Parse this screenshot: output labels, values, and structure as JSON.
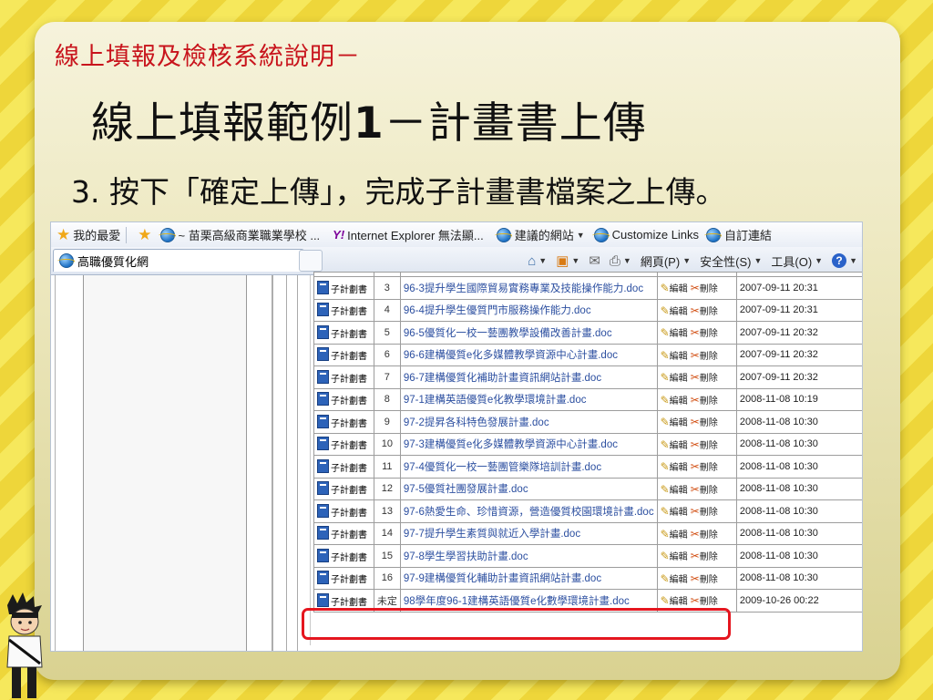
{
  "slide": {
    "subtitle": "線上填報及檢核系統說明－",
    "title_part1": "線上填報範例",
    "title_num": "1",
    "title_part2": "－計畫書上傳",
    "step_number": "3.",
    "step_text": " 按下「確定上傳」，完成子計畫書檔案之上傳。"
  },
  "browser": {
    "favorites_bar": {
      "favorites_label": "我的最愛",
      "items": [
        "~ 苗栗高級商業職業學校 ...",
        "Internet Explorer 無法顯...",
        "建議的網站",
        "Customize Links",
        "自訂連結"
      ]
    },
    "tab_title": "高職優質化網",
    "command_bar": {
      "page_menu": "網頁(P)",
      "safety_menu": "安全性(S)",
      "tools_menu": "工具(O)",
      "help_glyph": "?"
    }
  },
  "file_table": {
    "type_label": "子計劃書",
    "edit_label": "編輯",
    "delete_label": "刪除",
    "rows": [
      {
        "no": "3",
        "file": "96-3提升學生國際貿易實務專業及技能操作能力.doc",
        "date": "2007-09-11 20:31"
      },
      {
        "no": "4",
        "file": "96-4提升學生優質門市服務操作能力.doc",
        "date": "2007-09-11 20:31"
      },
      {
        "no": "5",
        "file": "96-5優質化一校一藝團教學設備改善計畫.doc",
        "date": "2007-09-11 20:32"
      },
      {
        "no": "6",
        "file": "96-6建構優質e化多媒體教學資源中心計畫.doc",
        "date": "2007-09-11 20:32"
      },
      {
        "no": "7",
        "file": "96-7建構優質化補助計畫資訊網站計畫.doc",
        "date": "2007-09-11 20:32"
      },
      {
        "no": "8",
        "file": "97-1建構英語優質e化教學環境計畫.doc",
        "date": "2008-11-08 10:19"
      },
      {
        "no": "9",
        "file": "97-2提昇各科特色發展計畫.doc",
        "date": "2008-11-08 10:30"
      },
      {
        "no": "10",
        "file": "97-3建構優質e化多媒體教學資源中心計畫.doc",
        "date": "2008-11-08 10:30"
      },
      {
        "no": "11",
        "file": "97-4優質化一校一藝團管樂隊培訓計畫.doc",
        "date": "2008-11-08 10:30"
      },
      {
        "no": "12",
        "file": "97-5優質社團發展計畫.doc",
        "date": "2008-11-08 10:30"
      },
      {
        "no": "13",
        "file": "97-6熱愛生命、珍惜資源，營造優質校園環境計畫.doc",
        "date": "2008-11-08 10:30"
      },
      {
        "no": "14",
        "file": "97-7提升學生素質與就近入學計畫.doc",
        "date": "2008-11-08 10:30"
      },
      {
        "no": "15",
        "file": "97-8學生學習扶助計畫.doc",
        "date": "2008-11-08 10:30"
      },
      {
        "no": "16",
        "file": "97-9建構優質化輔助計畫資訊網站計畫.doc",
        "date": "2008-11-08 10:30"
      },
      {
        "no": "未定",
        "file": "98學年度96-1建構英語優質e化數學環境計畫.doc",
        "date": "2009-10-26 00:22"
      }
    ]
  },
  "colors": {
    "subtitle": "#c8141c",
    "highlight_box": "#e5161f",
    "link": "#2c4fa0"
  }
}
